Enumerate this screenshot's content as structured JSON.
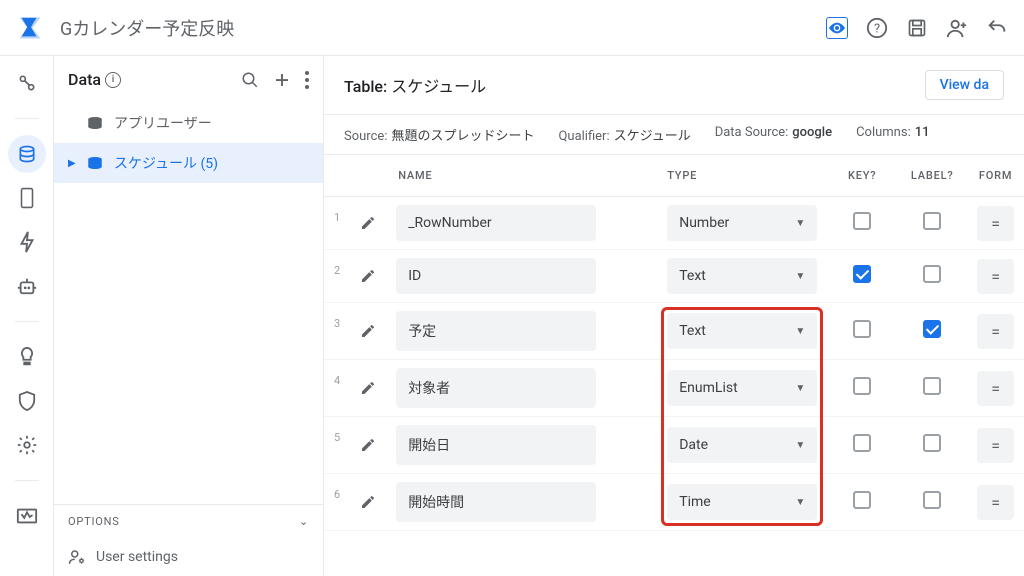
{
  "header": {
    "app_title": "Gカレンダー予定反映"
  },
  "sidebar": {
    "title": "Data",
    "items": [
      {
        "label": "アプリユーザー",
        "selected": false
      },
      {
        "label": "スケジュール (5)",
        "selected": true
      }
    ],
    "options_label": "OPTIONS",
    "user_settings_label": "User settings"
  },
  "main": {
    "table_label_prefix": "Table:",
    "table_name": "スケジュール",
    "view_data_label": "View da",
    "meta": {
      "source_label": "Source:",
      "source_value": "無題のスプレッドシート",
      "qualifier_label": "Qualifier:",
      "qualifier_value": "スケジュール",
      "datasource_label": "Data Source:",
      "datasource_value": "google",
      "columns_label": "Columns:",
      "columns_value": "11"
    },
    "columns": {
      "name": "NAME",
      "type": "TYPE",
      "key": "KEY?",
      "label": "LABEL?",
      "formula": "FORM"
    },
    "rows": [
      {
        "idx": "1",
        "name": "_RowNumber",
        "type": "Number",
        "key": false,
        "label": false,
        "red": false
      },
      {
        "idx": "2",
        "name": "ID",
        "type": "Text",
        "key": true,
        "label": false,
        "red": false
      },
      {
        "idx": "3",
        "name": "予定",
        "type": "Text",
        "key": false,
        "label": true,
        "red": true
      },
      {
        "idx": "4",
        "name": "対象者",
        "type": "EnumList",
        "key": false,
        "label": false,
        "red": true
      },
      {
        "idx": "5",
        "name": "開始日",
        "type": "Date",
        "key": false,
        "label": false,
        "red": true
      },
      {
        "idx": "6",
        "name": "開始時間",
        "type": "Time",
        "key": false,
        "label": false,
        "red": true
      }
    ]
  }
}
